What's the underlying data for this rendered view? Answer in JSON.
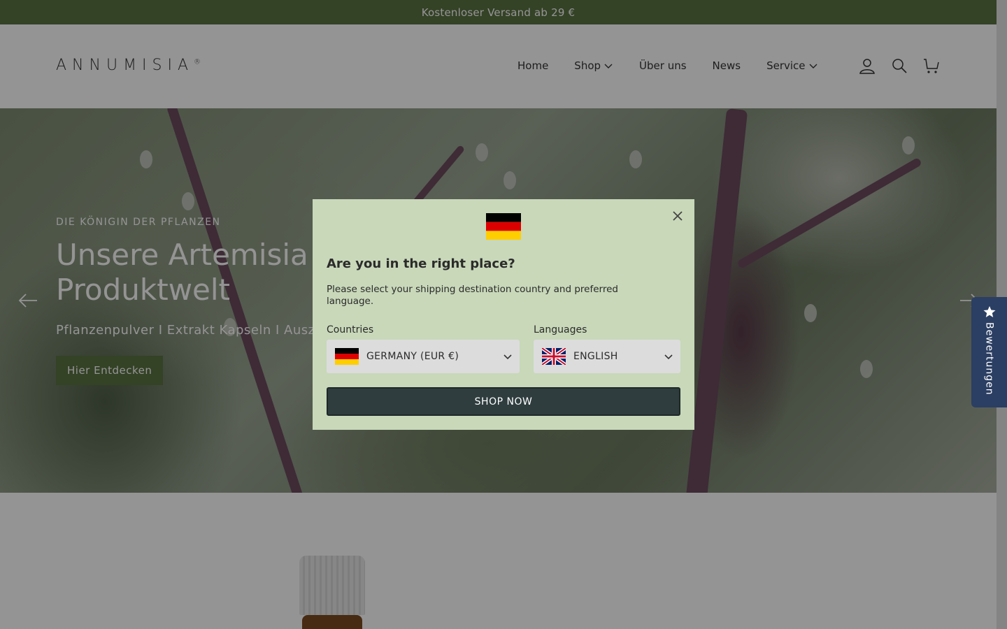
{
  "announcement": "Kostenloser Versand ab 29 €",
  "header": {
    "logo": "ANNUMISIA",
    "logo_mark": "®",
    "nav": [
      {
        "label": "Home",
        "has_dropdown": false
      },
      {
        "label": "Shop",
        "has_dropdown": true
      },
      {
        "label": "Über uns",
        "has_dropdown": false
      },
      {
        "label": "News",
        "has_dropdown": false
      },
      {
        "label": "Service",
        "has_dropdown": true
      }
    ],
    "icons": [
      "account-icon",
      "search-icon",
      "cart-icon"
    ]
  },
  "hero": {
    "kicker": "DIE KÖNIGIN DER PFLANZEN",
    "title": "Unsere Artemisia Produktwelt",
    "subtitle": "Pflanzenpulver I Extrakt Kapseln I Auszug",
    "cta": "Hier Entdecken"
  },
  "reviews_tab": {
    "label": "Bewertungen"
  },
  "modal": {
    "title": "Are you in the right place?",
    "description": "Please select your shipping destination country and preferred language.",
    "countries_label": "Countries",
    "country_value": "GERMANY (EUR €)",
    "languages_label": "Languages",
    "language_value": "ENGLISH",
    "submit": "SHOP NOW"
  },
  "colors": {
    "brand_green": "#5a7343",
    "modal_bg": "#c8d8b9",
    "button_dark": "#2f3d3f",
    "reviews_tab": "#2b3e63"
  }
}
